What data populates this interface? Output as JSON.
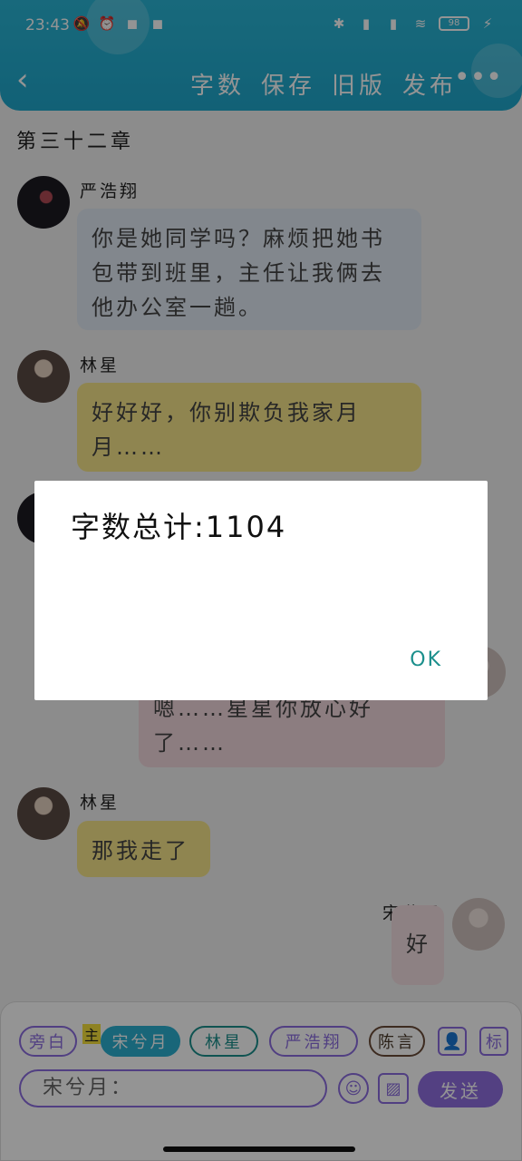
{
  "status": {
    "time": "23:43",
    "battery": "98",
    "left_icons": [
      "mute-icon",
      "alarm-icon",
      "app1-icon",
      "app2-icon"
    ],
    "right_icons": [
      "bluetooth-icon",
      "hd-signal-icon",
      "hd-signal-icon",
      "wifi-icon",
      "battery-icon",
      "charge-icon"
    ]
  },
  "header": {
    "back": "<",
    "menu": [
      "字数",
      "保存",
      "旧版",
      "发布"
    ],
    "more": "•••"
  },
  "chapter": "第三十二章",
  "messages": [
    {
      "name": "严浩翔",
      "text": "你是她同学吗？麻烦把她书包带到班里，主任让我俩去他办公室一趟。"
    },
    {
      "name": "林星",
      "text": "好好好，你别欺负我家月月……"
    },
    {
      "name": "",
      "text": "嗯……星星你放心好了……"
    },
    {
      "name": "林星",
      "text": "那我走了"
    },
    {
      "name": "宋兮月",
      "text": "好"
    }
  ],
  "composer": {
    "chips": [
      "旁白",
      "宋兮月",
      "林星",
      "严浩翔",
      "陈言"
    ],
    "main_badge": "主",
    "icon_user": "user-icon",
    "icon_mark": "标",
    "input_value": "宋兮月：",
    "send": "发送"
  },
  "dialog": {
    "title": "字数总计:1104",
    "ok": "OK"
  },
  "colors": {
    "header": "#2ab6d6",
    "accent": "#8f6ee0",
    "teal": "#1b8f8c"
  }
}
